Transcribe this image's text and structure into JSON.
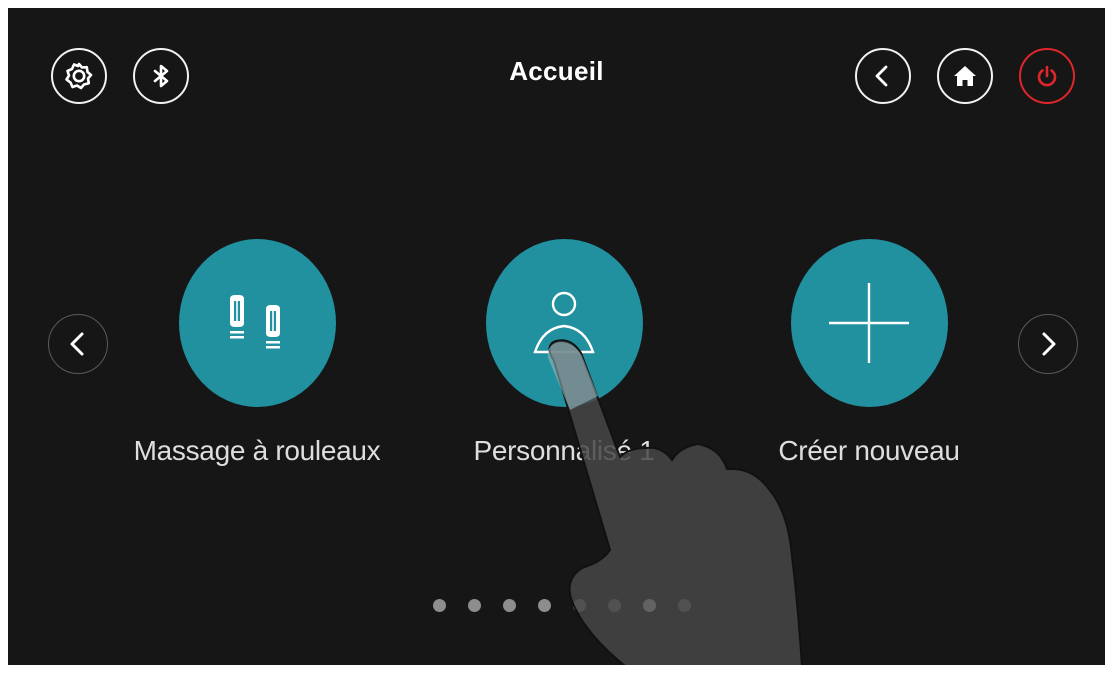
{
  "header": {
    "title": "Accueil",
    "left_icons": [
      "settings-icon",
      "bluetooth-icon"
    ],
    "right_icons": [
      "back-icon",
      "home-icon",
      "power-icon"
    ],
    "power_color": "#e0262a"
  },
  "carousel": {
    "tiles": [
      {
        "label": "Massage à rouleaux",
        "icon": "rollers-icon"
      },
      {
        "label": "Personnalisé 1",
        "icon": "user-icon"
      },
      {
        "label": "Créer nouveau",
        "icon": "plus-icon"
      }
    ],
    "tile_color": "#21909f",
    "page_count": 8,
    "active_page": 7
  },
  "overlay": {
    "icon": "pointing-hand-icon"
  }
}
